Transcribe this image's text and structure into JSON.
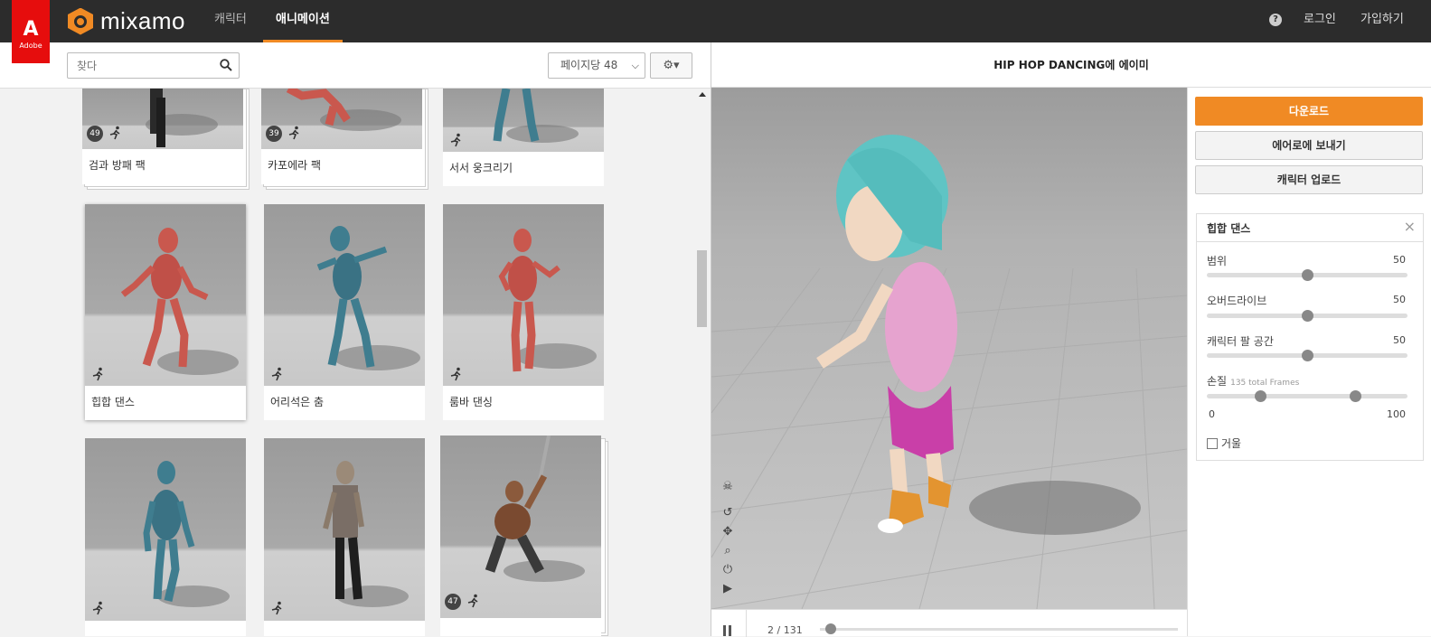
{
  "brand": {
    "adobe_logo": "A",
    "adobe_text": "Adobe",
    "name": "mixamo",
    "accent": "#f08a24",
    "adobe_red": "#e60d0d"
  },
  "nav": {
    "tabs": [
      "캐릭터",
      "애니메이션"
    ],
    "active_tab": "애니메이션",
    "help": "?",
    "login": "로그인",
    "signup": "가입하기"
  },
  "toolbar": {
    "search_placeholder": "찾다",
    "per_page": "페이지당 48",
    "settings_icon": "gear-icon"
  },
  "grid": {
    "cards": [
      {
        "label": "검과 방패 팩",
        "count": "49",
        "pack": true
      },
      {
        "label": "카포에라 팩",
        "count": "39",
        "pack": true
      },
      {
        "label": "서서 웅크리기",
        "count": "",
        "pack": false
      },
      {
        "label": "힙합 댄스",
        "count": "",
        "pack": false,
        "selected": true
      },
      {
        "label": "어리석은 춤",
        "count": "",
        "pack": false
      },
      {
        "label": "룸바 댄싱",
        "count": "",
        "pack": false
      },
      {
        "label": "",
        "count": "",
        "pack": false
      },
      {
        "label": "",
        "count": "",
        "pack": false
      },
      {
        "label": "",
        "count": "47",
        "pack": true
      }
    ]
  },
  "viewer": {
    "title_bold": "HIP HOP DANCING",
    "title_rest": "에 에이미",
    "frame": "2 / 131"
  },
  "actions": {
    "download": "다운로드",
    "send_to_aero": "에어로에 보내기",
    "upload_character": "캐릭터 업로드"
  },
  "settings_panel": {
    "title": "힙합 댄스",
    "close": "×",
    "sliders": [
      {
        "label": "범위",
        "value": "50",
        "level": 0.5
      },
      {
        "label": "오버드라이브",
        "value": "50",
        "level": 0.5
      },
      {
        "label": "캐릭터 팔 공간",
        "value": "50",
        "level": 0.5
      }
    ],
    "trim": {
      "label": "손질",
      "sub": "135 total Frames",
      "min": "0",
      "max": "100",
      "start": 0.27,
      "end": 0.74
    },
    "mirror": "거울"
  }
}
